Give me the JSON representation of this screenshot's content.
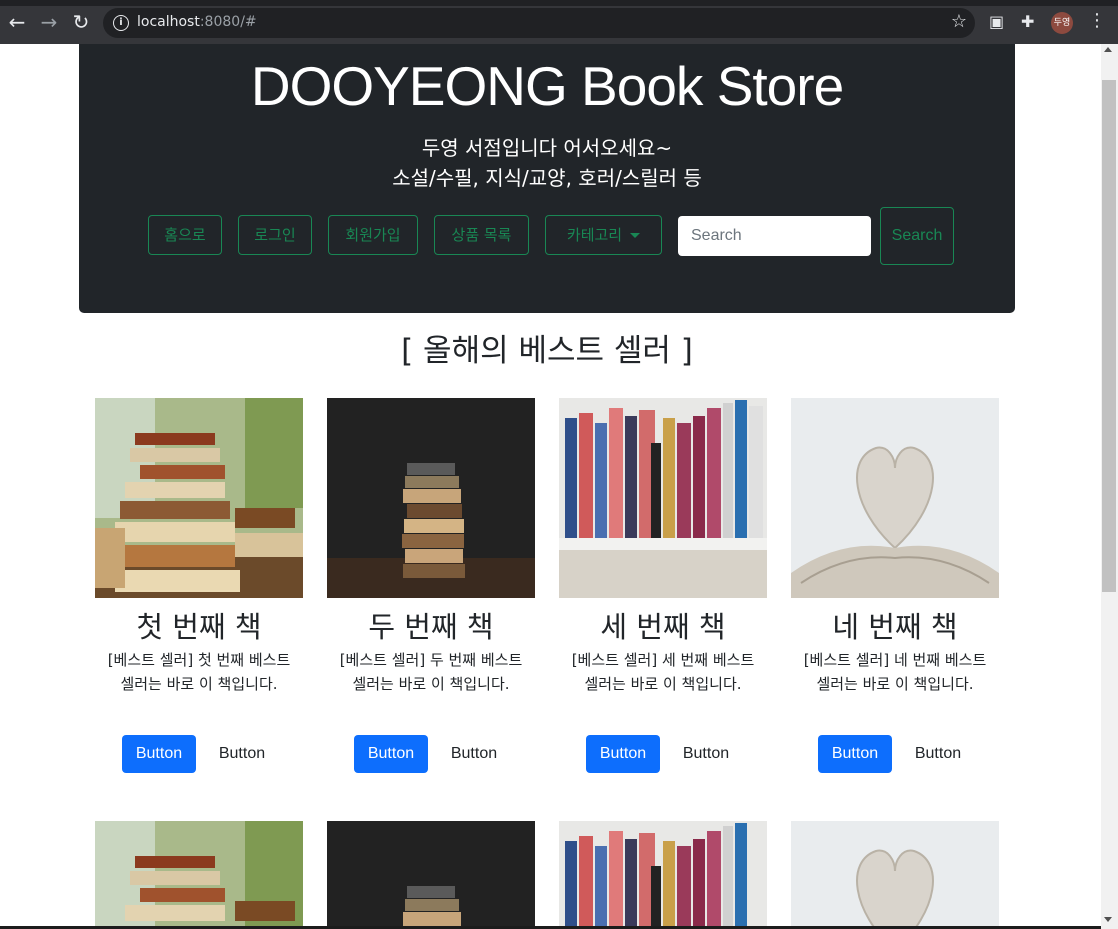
{
  "browser": {
    "url_host": "localhost",
    "url_rest": ":8080/#",
    "profile_label": "두영"
  },
  "header": {
    "title": "DOOYEONG Book Store",
    "subtitle_line1": "두영 서점입니다 어서오세요~",
    "subtitle_line2": "소설/수필, 지식/교양, 호러/스릴러 등",
    "nav": {
      "home": "홈으로",
      "login": "로그인",
      "signup": "회원가입",
      "products": "상품 목록",
      "category": "카테고리"
    },
    "search": {
      "placeholder": "Search",
      "button": "Search"
    }
  },
  "section_title": "[ 올해의 베스트 셀러 ]",
  "cards": [
    {
      "title": "첫 번째 책",
      "desc": "[베스트 셀러] 첫 번째 베스트 셀러는 바로 이 책입니다.",
      "primary": "Button",
      "secondary": "Button"
    },
    {
      "title": "두 번째 책",
      "desc": "[베스트 셀러] 두 번째 베스트 셀러는 바로 이 책입니다.",
      "primary": "Button",
      "secondary": "Button"
    },
    {
      "title": "세 번째 책",
      "desc": "[베스트 셀러] 세 번째 베스트 셀러는 바로 이 책입니다.",
      "primary": "Button",
      "secondary": "Button"
    },
    {
      "title": "네 번째 책",
      "desc": "[베스트 셀러] 네 번째 베스트 셀러는 바로 이 책입니다.",
      "primary": "Button",
      "secondary": "Button"
    }
  ],
  "colors": {
    "header_bg": "#212529",
    "outline_green": "#198754",
    "primary_blue": "#0d6efd"
  }
}
